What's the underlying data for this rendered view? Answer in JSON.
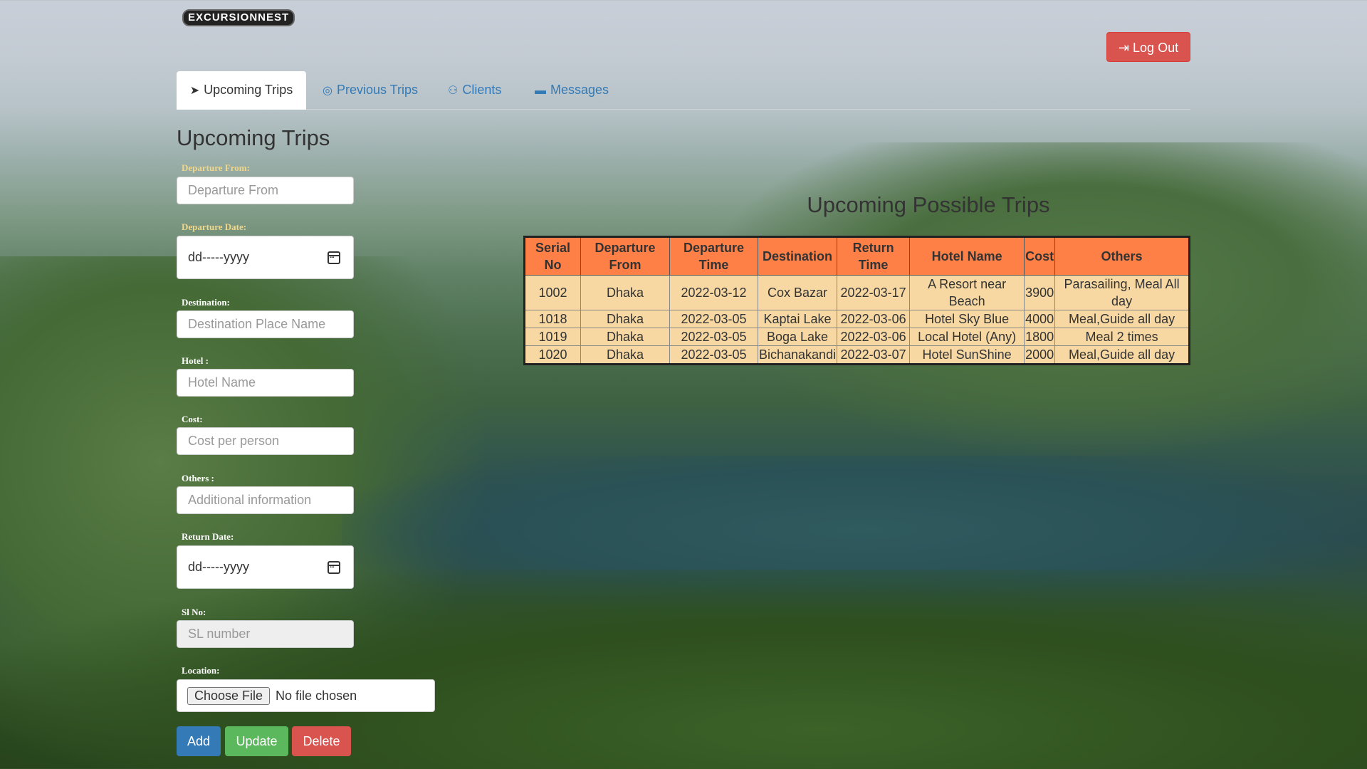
{
  "brand": {
    "logo_text": "EXCURSIONNEST"
  },
  "header": {
    "logout_label": "Log Out"
  },
  "tabs": [
    {
      "label": "Upcoming Trips",
      "icon": "paper-plane-icon",
      "active": true
    },
    {
      "label": "Previous Trips",
      "icon": "globe-icon",
      "active": false
    },
    {
      "label": "Clients",
      "icon": "users-icon",
      "active": false
    },
    {
      "label": "Messages",
      "icon": "comment-icon",
      "active": false
    }
  ],
  "form": {
    "title": "Upcoming Trips",
    "departure_from": {
      "label": "Departure From:",
      "placeholder": "Departure From"
    },
    "departure_date": {
      "label": "Departure Date:",
      "value": "dd-----yyyy"
    },
    "destination": {
      "label": "Destination:",
      "placeholder": "Destination Place Name"
    },
    "hotel": {
      "label": "Hotel :",
      "placeholder": "Hotel Name"
    },
    "cost": {
      "label": "Cost:",
      "placeholder": "Cost per person"
    },
    "others": {
      "label": "Others :",
      "placeholder": "Additional information"
    },
    "return_date": {
      "label": "Return Date:",
      "value": "dd-----yyyy"
    },
    "sl_no": {
      "label": "Sl No:",
      "placeholder": "SL number"
    },
    "location": {
      "label": "Location:",
      "button": "Choose File",
      "status": "No file chosen"
    },
    "buttons": {
      "add": "Add",
      "update": "Update",
      "delete": "Delete"
    }
  },
  "trips_table": {
    "title": "Upcoming Possible Trips",
    "headers": [
      "Serial No",
      "Departure From",
      "Departure Time",
      "Destination",
      "Return Time",
      "Hotel Name",
      "Cost",
      "Others"
    ],
    "rows": [
      [
        "1002",
        "Dhaka",
        "2022-03-12",
        "Cox Bazar",
        "2022-03-17",
        "A Resort near Beach",
        "3900",
        "Parasailing, Meal All day"
      ],
      [
        "1018",
        "Dhaka",
        "2022-03-05",
        "Kaptai Lake",
        "2022-03-06",
        "Hotel Sky Blue",
        "4000",
        "Meal,Guide all day"
      ],
      [
        "1019",
        "Dhaka",
        "2022-03-05",
        "Boga Lake",
        "2022-03-06",
        "Local Hotel (Any)",
        "1800",
        "Meal 2 times"
      ],
      [
        "1020",
        "Dhaka",
        "2022-03-05",
        "Bichanakandi",
        "2022-03-07",
        "Hotel SunShine",
        "2000",
        "Meal,Guide all day"
      ]
    ]
  },
  "colors": {
    "header_row": "#ff8047",
    "body_rows": "#f7d8a2",
    "primary": "#337ab7",
    "success": "#5cb85c",
    "danger": "#d9534f"
  }
}
